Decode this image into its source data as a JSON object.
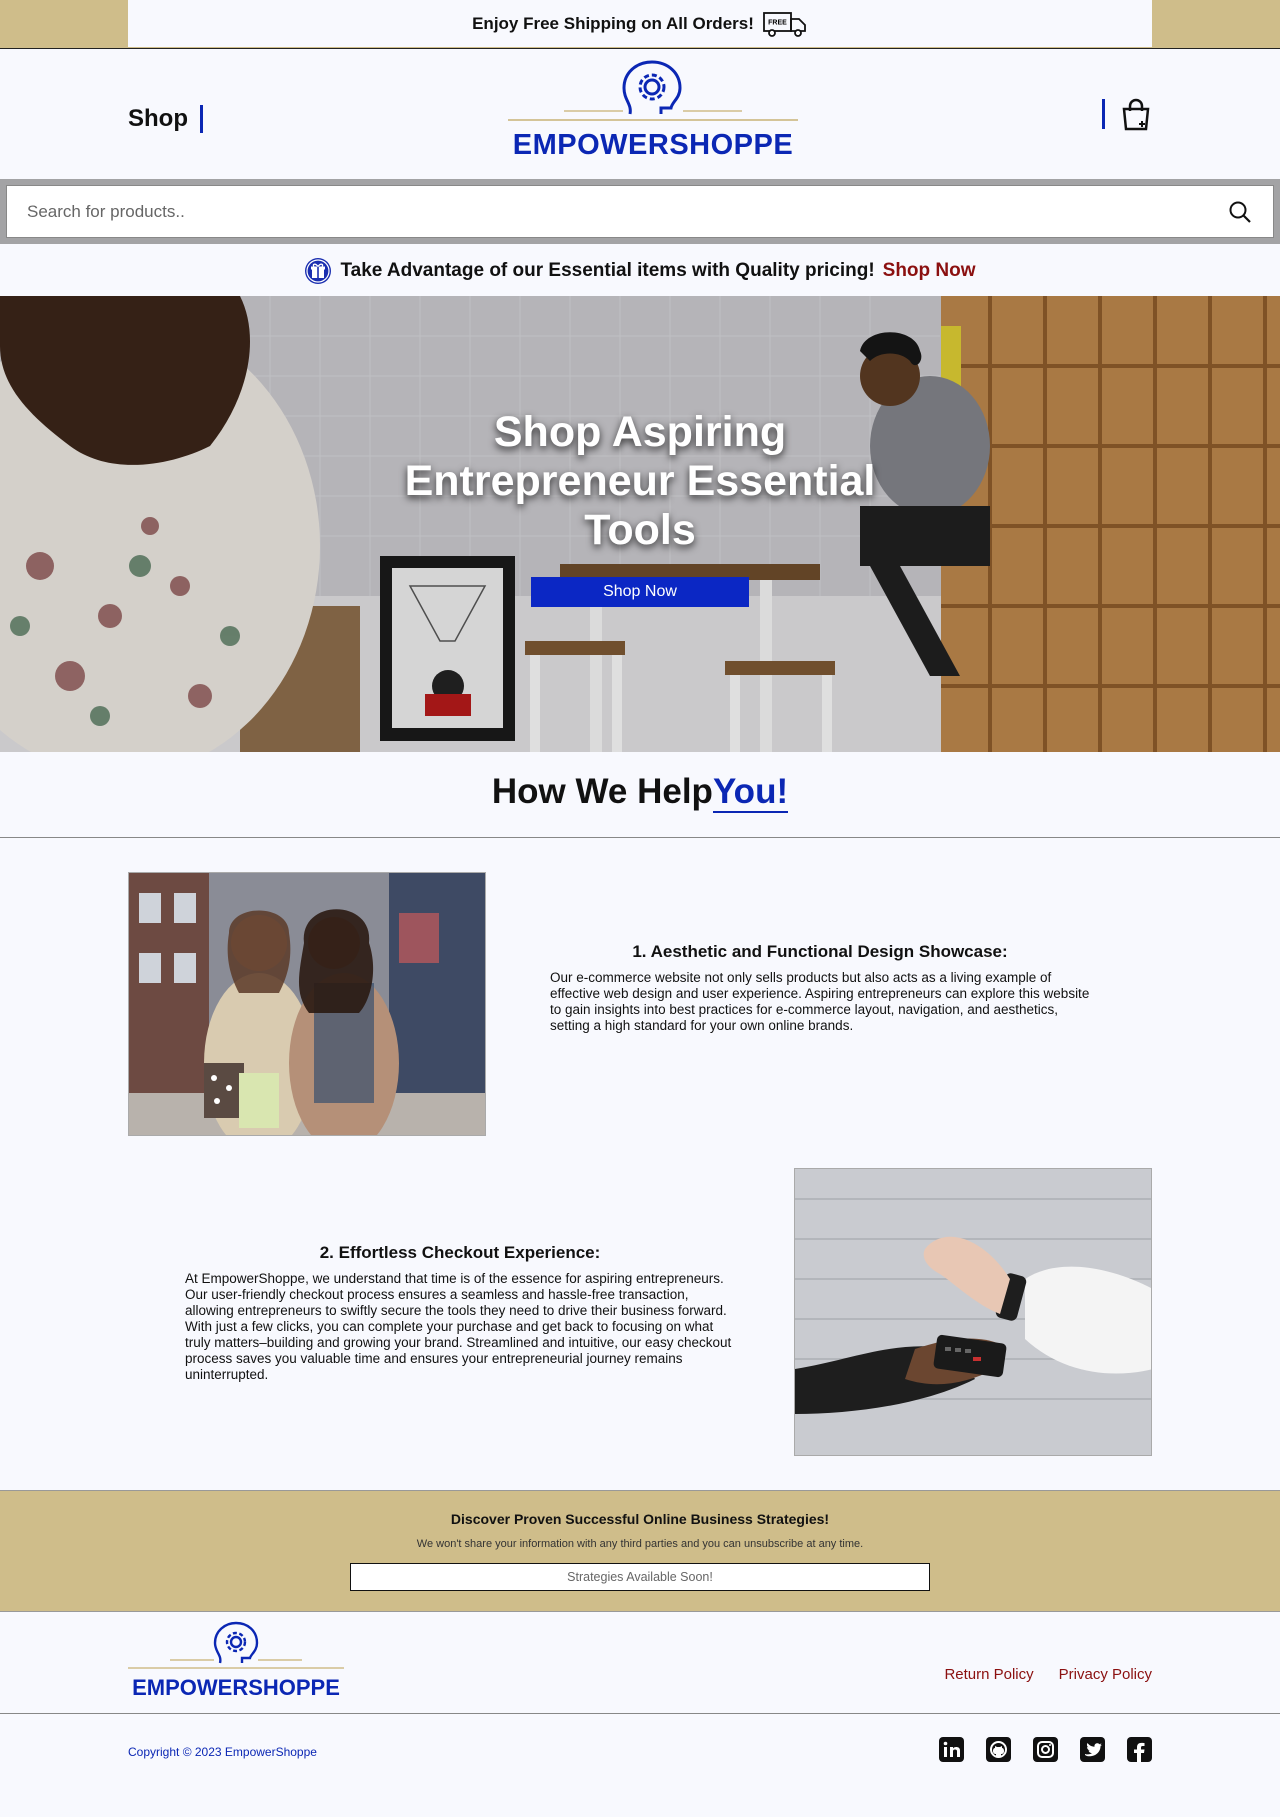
{
  "topbar": {
    "text": "Enjoy Free Shipping on All Orders!",
    "truck_badge": "FREE",
    "icon": "delivery-truck-icon"
  },
  "header": {
    "shop_label": "Shop",
    "logo_text": "EMPOWERSHOPPE",
    "cart_icon": "shopping-bag-icon"
  },
  "search": {
    "placeholder": "Search for products..",
    "icon": "search-icon"
  },
  "promo": {
    "text": "Take Advantage of our Essential items with Quality pricing!",
    "link": "Shop Now",
    "icon": "gift-icon"
  },
  "hero": {
    "title": "Shop Aspiring Entrepreneur Essential Tools",
    "button": "Shop Now"
  },
  "help": {
    "title": "How We Help",
    "title_accent": "You!"
  },
  "features": [
    {
      "title": "1. Aesthetic and Functional Design Showcase:",
      "body": "Our e-commerce website not only sells products but also acts as a living example of effective web design and user experience. Aspiring entrepreneurs can explore this website to gain insights into best practices for e-commerce layout, navigation, and aesthetics, setting a high standard for your own online brands."
    },
    {
      "title": "2. Effortless Checkout Experience:",
      "body": "At EmpowerShoppe, we understand that time is of the essence for aspiring entrepreneurs. Our user-friendly checkout process ensures a seamless and hassle-free transaction, allowing entrepreneurs to swiftly secure the tools they need to drive their business forward. With just a few clicks, you can complete your purchase and get back to focusing on what truly matters–building and growing your brand. Streamlined and intuitive, our easy checkout process saves you valuable time and ensures your entrepreneurial journey remains uninterrupted."
    }
  ],
  "newsletter": {
    "title": "Discover Proven Successful Online Business Strategies!",
    "subtitle": "We won't share your information with any third parties and you can unsubscribe at any time.",
    "field_text": "Strategies Available Soon!"
  },
  "footer": {
    "logo_text": "EMPOWERSHOPPE",
    "links": [
      "Return Policy",
      "Privacy Policy"
    ],
    "copyright": "Copyright © 2023 EmpowerShoppe",
    "socials": [
      "linkedin-icon",
      "github-icon",
      "instagram-icon",
      "twitter-icon",
      "facebook-icon"
    ]
  },
  "colors": {
    "brand_blue": "#0b27b4",
    "gold": "#cfbd8a",
    "accent_red": "#8b1010",
    "background": "#f8f9fe"
  }
}
